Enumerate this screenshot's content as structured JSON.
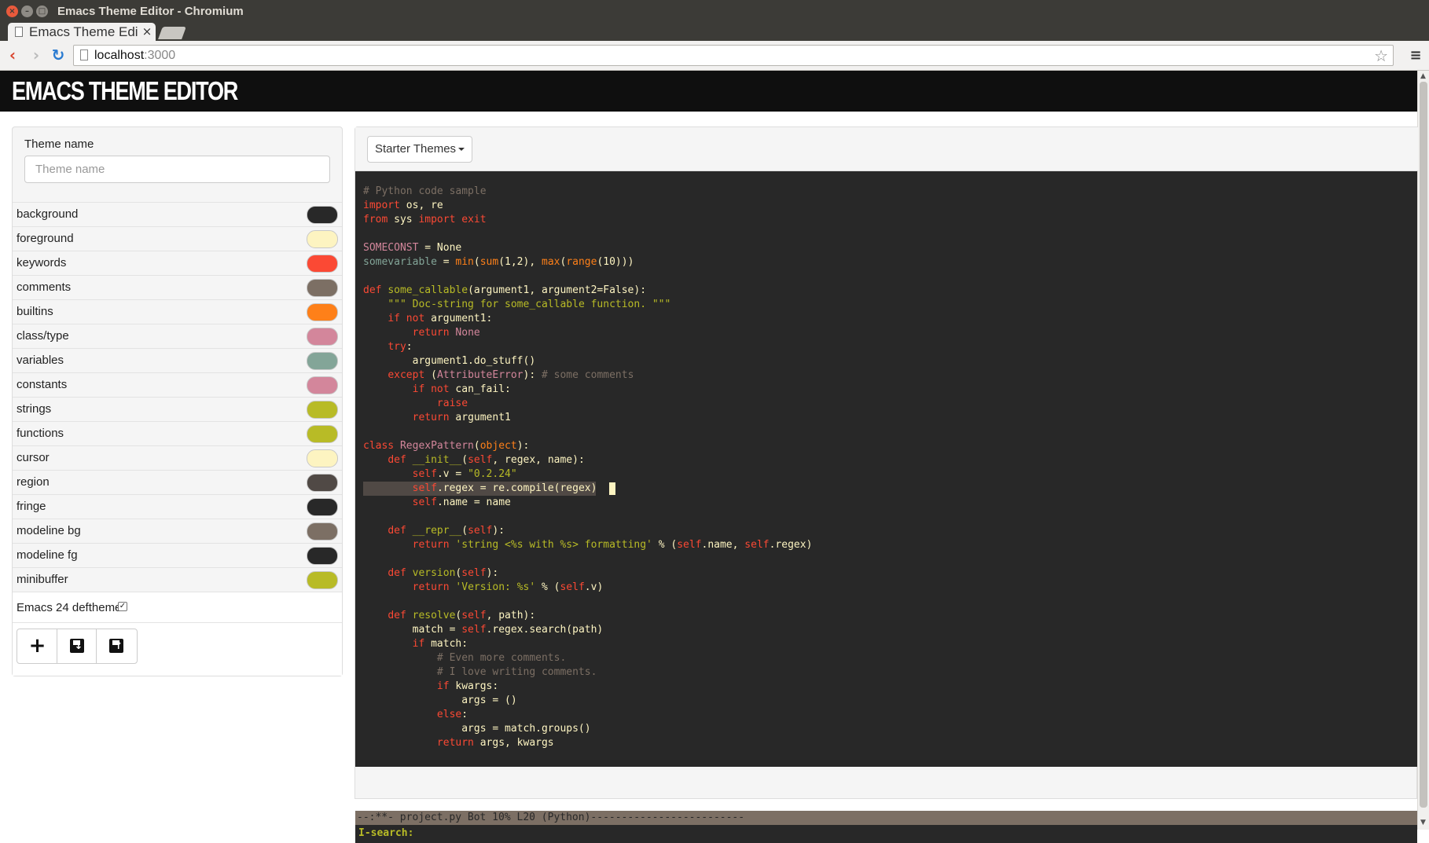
{
  "browser": {
    "window_title": "Emacs Theme Editor - Chromium",
    "tab_title": "Emacs Theme Edi",
    "tab_close": "×",
    "url_host": "localhost",
    "url_port": ":3000"
  },
  "app": {
    "title": "EMACS THEME EDITOR"
  },
  "sidebar": {
    "theme_name_label": "Theme name",
    "theme_name_placeholder": "Theme name",
    "theme_name_value": "",
    "colors": [
      {
        "label": "background",
        "color": "#282828"
      },
      {
        "label": "foreground",
        "color": "#fdf4c1"
      },
      {
        "label": "keywords",
        "color": "#fb4934"
      },
      {
        "label": "comments",
        "color": "#7c6f64"
      },
      {
        "label": "builtins",
        "color": "#fe8019"
      },
      {
        "label": "class/type",
        "color": "#d3869b"
      },
      {
        "label": "variables",
        "color": "#83a598"
      },
      {
        "label": "constants",
        "color": "#d3869b"
      },
      {
        "label": "strings",
        "color": "#b8bb26"
      },
      {
        "label": "functions",
        "color": "#b8bb26"
      },
      {
        "label": "cursor",
        "color": "#fdf4c1"
      },
      {
        "label": "region",
        "color": "#504945"
      },
      {
        "label": "fringe",
        "color": "#282828"
      },
      {
        "label": "modeline bg",
        "color": "#7c6f64"
      },
      {
        "label": "modeline fg",
        "color": "#282828"
      },
      {
        "label": "minibuffer",
        "color": "#b8bb26"
      }
    ],
    "deftheme_label": "Emacs 24 deftheme",
    "deftheme_checked": true,
    "buttons": [
      {
        "name": "add-button",
        "icon": "plus-icon"
      },
      {
        "name": "save-button",
        "icon": "save-download-icon"
      },
      {
        "name": "export-button",
        "icon": "save-upload-icon"
      }
    ]
  },
  "editor": {
    "starter_themes_label": "Starter Themes",
    "lines": [
      [
        [
          "cm",
          "# Python code sample"
        ]
      ],
      [
        [
          "kw",
          "import"
        ],
        [
          "tx",
          " os, re"
        ]
      ],
      [
        [
          "kw",
          "from"
        ],
        [
          "tx",
          " sys "
        ],
        [
          "kw",
          "import"
        ],
        [
          "tx",
          " "
        ],
        [
          "kw",
          "exit"
        ]
      ],
      [],
      [
        [
          "cs",
          "SOMECONST"
        ],
        [
          "tx",
          " = None"
        ]
      ],
      [
        [
          "vr",
          "somevariable"
        ],
        [
          "tx",
          " = "
        ],
        [
          "bi",
          "min"
        ],
        [
          "tx",
          "("
        ],
        [
          "bi",
          "sum"
        ],
        [
          "tx",
          "(1,2), "
        ],
        [
          "bi",
          "max"
        ],
        [
          "tx",
          "("
        ],
        [
          "bi",
          "range"
        ],
        [
          "tx",
          "(10)))"
        ]
      ],
      [],
      [
        [
          "kw",
          "def"
        ],
        [
          "tx",
          " "
        ],
        [
          "fn",
          "some_callable"
        ],
        [
          "tx",
          "(argument1, argument2=False):"
        ]
      ],
      [
        [
          "tx",
          "    "
        ],
        [
          "st",
          "\"\"\" Doc-string for some_callable function. \"\"\""
        ]
      ],
      [
        [
          "tx",
          "    "
        ],
        [
          "kw",
          "if"
        ],
        [
          "tx",
          " "
        ],
        [
          "kw",
          "not"
        ],
        [
          "tx",
          " argument1:"
        ]
      ],
      [
        [
          "tx",
          "        "
        ],
        [
          "kw",
          "return"
        ],
        [
          "tx",
          " "
        ],
        [
          "ct",
          "None"
        ]
      ],
      [
        [
          "tx",
          "    "
        ],
        [
          "kw",
          "try"
        ],
        [
          "tx",
          ":"
        ]
      ],
      [
        [
          "tx",
          "        argument1.do_stuff()"
        ]
      ],
      [
        [
          "tx",
          "    "
        ],
        [
          "kw",
          "except"
        ],
        [
          "tx",
          " ("
        ],
        [
          "ct",
          "AttributeError"
        ],
        [
          "tx",
          "): "
        ],
        [
          "cm",
          "# some comments"
        ]
      ],
      [
        [
          "tx",
          "        "
        ],
        [
          "kw",
          "if"
        ],
        [
          "tx",
          " "
        ],
        [
          "kw",
          "not"
        ],
        [
          "tx",
          " can_fail:"
        ]
      ],
      [
        [
          "tx",
          "            "
        ],
        [
          "kw",
          "raise"
        ]
      ],
      [
        [
          "tx",
          "        "
        ],
        [
          "kw",
          "return"
        ],
        [
          "tx",
          " argument1"
        ]
      ],
      [],
      [
        [
          "kw",
          "class"
        ],
        [
          "tx",
          " "
        ],
        [
          "ct",
          "RegexPattern"
        ],
        [
          "tx",
          "("
        ],
        [
          "bi",
          "object"
        ],
        [
          "tx",
          "):"
        ]
      ],
      [
        [
          "tx",
          "    "
        ],
        [
          "kw",
          "def"
        ],
        [
          "tx",
          " "
        ],
        [
          "fn",
          "__init__"
        ],
        [
          "tx",
          "("
        ],
        [
          "kw",
          "self"
        ],
        [
          "tx",
          ", regex, name):"
        ]
      ],
      [
        [
          "tx",
          "        "
        ],
        [
          "kw",
          "self"
        ],
        [
          "tx",
          ".v = "
        ],
        [
          "st",
          "\"0.2.24\""
        ]
      ],
      [
        [
          "tx",
          "        "
        ],
        [
          "kw",
          "self"
        ],
        [
          "tx",
          ".regex = re.compile(regex)"
        ]
      ],
      [
        [
          "tx",
          "        "
        ],
        [
          "kw",
          "self"
        ],
        [
          "tx",
          ".name = name"
        ]
      ],
      [],
      [
        [
          "tx",
          "    "
        ],
        [
          "kw",
          "def"
        ],
        [
          "tx",
          " "
        ],
        [
          "fn",
          "__repr__"
        ],
        [
          "tx",
          "("
        ],
        [
          "kw",
          "self"
        ],
        [
          "tx",
          "):"
        ]
      ],
      [
        [
          "tx",
          "        "
        ],
        [
          "kw",
          "return"
        ],
        [
          "tx",
          " "
        ],
        [
          "st",
          "'string <%s with %s> formatting'"
        ],
        [
          "tx",
          " % ("
        ],
        [
          "kw",
          "self"
        ],
        [
          "tx",
          ".name, "
        ],
        [
          "kw",
          "self"
        ],
        [
          "tx",
          ".regex)"
        ]
      ],
      [],
      [
        [
          "tx",
          "    "
        ],
        [
          "kw",
          "def"
        ],
        [
          "tx",
          " "
        ],
        [
          "fn",
          "version"
        ],
        [
          "tx",
          "("
        ],
        [
          "kw",
          "self"
        ],
        [
          "tx",
          "):"
        ]
      ],
      [
        [
          "tx",
          "        "
        ],
        [
          "kw",
          "return"
        ],
        [
          "tx",
          " "
        ],
        [
          "st",
          "'Version: %s'"
        ],
        [
          "tx",
          " % ("
        ],
        [
          "kw",
          "self"
        ],
        [
          "tx",
          ".v)"
        ]
      ],
      [],
      [
        [
          "tx",
          "    "
        ],
        [
          "kw",
          "def"
        ],
        [
          "tx",
          " "
        ],
        [
          "fn",
          "resolve"
        ],
        [
          "tx",
          "("
        ],
        [
          "kw",
          "self"
        ],
        [
          "tx",
          ", path):"
        ]
      ],
      [
        [
          "tx",
          "        match = "
        ],
        [
          "kw",
          "self"
        ],
        [
          "tx",
          ".regex.search(path)"
        ]
      ],
      [
        [
          "tx",
          "        "
        ],
        [
          "kw",
          "if"
        ],
        [
          "tx",
          " match:"
        ]
      ],
      [
        [
          "tx",
          "            "
        ],
        [
          "cm",
          "# Even more comments."
        ]
      ],
      [
        [
          "tx",
          "            "
        ],
        [
          "cm",
          "# I love writing comments."
        ]
      ],
      [
        [
          "tx",
          "            "
        ],
        [
          "kw",
          "if"
        ],
        [
          "tx",
          " kwargs:"
        ]
      ],
      [
        [
          "tx",
          "                args = ()"
        ]
      ],
      [
        [
          "tx",
          "            "
        ],
        [
          "kw",
          "else"
        ],
        [
          "tx",
          ":"
        ]
      ],
      [
        [
          "tx",
          "                args = match.groups()"
        ]
      ],
      [
        [
          "tx",
          "            "
        ],
        [
          "kw",
          "return"
        ],
        [
          "tx",
          " args, kwargs"
        ]
      ]
    ],
    "region_line": 21,
    "modeline": "--:**- project.py Bot 10% L20 (Python)-------------------------",
    "minibuffer": "I-search:"
  }
}
